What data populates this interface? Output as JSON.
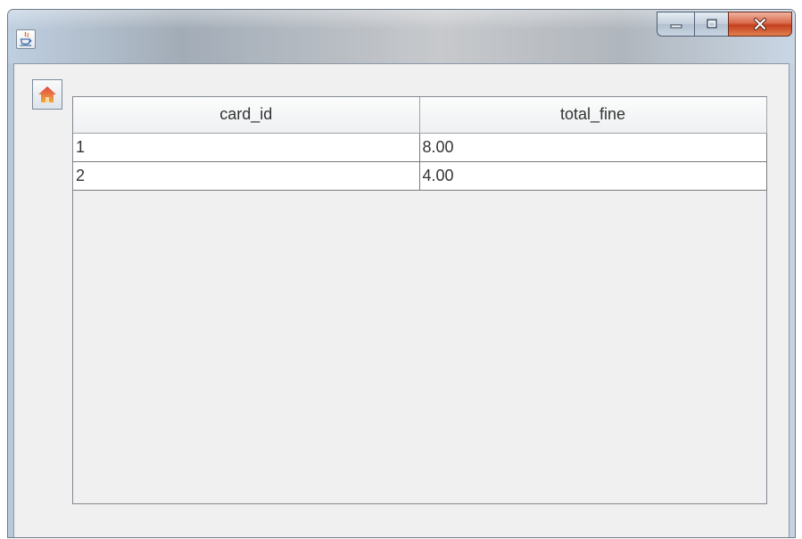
{
  "window": {
    "title": "",
    "app_icon": "java-coffee-cup-icon",
    "controls": {
      "minimize_icon": "minimize-icon",
      "maximize_icon": "maximize-icon",
      "close_icon": "close-icon"
    }
  },
  "toolbar": {
    "home_icon": "home-icon"
  },
  "table": {
    "columns": [
      "card_id",
      "total_fine"
    ],
    "rows": [
      [
        "1",
        "8.00"
      ],
      [
        "2",
        "4.00"
      ]
    ]
  },
  "colors": {
    "client_background": "#f0f0f0",
    "close_button": "#c4401f",
    "home_icon_top": "#e04848",
    "home_icon_bottom": "#f2a93b"
  }
}
